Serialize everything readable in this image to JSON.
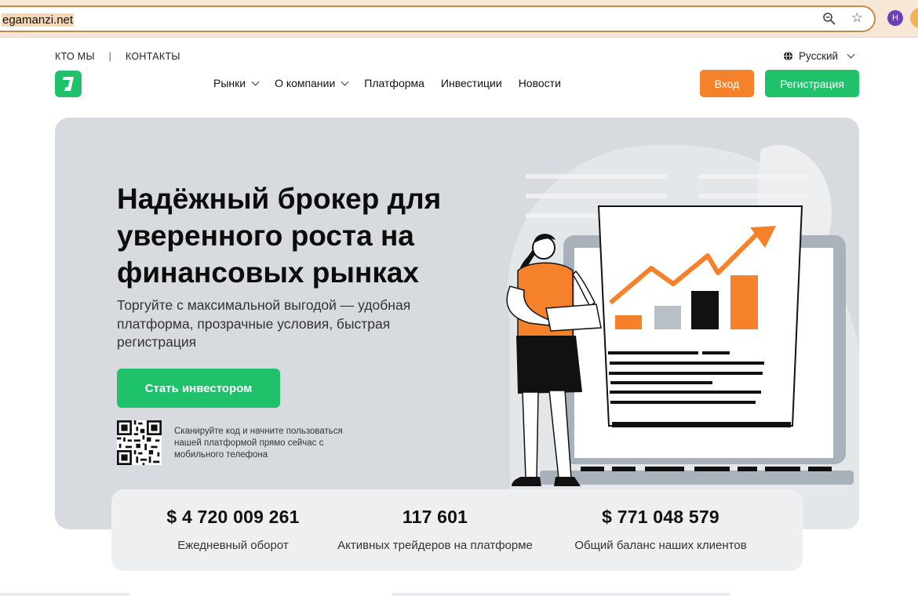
{
  "browser": {
    "url": "egamanzi.net",
    "profile_initial": "H"
  },
  "toplinks": {
    "about": "КТО МЫ",
    "separator": "|",
    "contacts": "КОНТАКТЫ"
  },
  "language": {
    "label": "Русский",
    "icon": "globe-icon"
  },
  "nav": {
    "items": [
      {
        "label": "Рынки",
        "dropdown": true
      },
      {
        "label": "О компании",
        "dropdown": true
      },
      {
        "label": "Платформа",
        "dropdown": false
      },
      {
        "label": "Инвестиции",
        "dropdown": false
      },
      {
        "label": "Новости",
        "dropdown": false
      }
    ]
  },
  "auth": {
    "login": "Вход",
    "register": "Регистрация"
  },
  "hero": {
    "title": "Надёжный брокер для уверенного роста на финансовых рынках",
    "subtitle": "Торгуйте с максимальной выгодой — удобная платформа, прозрачные условия, быстрая регистрация",
    "cta": "Стать инвестором",
    "qr_text": "Сканируйте код и начните пользоваться нашей платформой прямо сейчас с мобильного телефона"
  },
  "stats": [
    {
      "value": "$ 4 720 009 261",
      "label": "Ежедневный оборот"
    },
    {
      "value": "117 601",
      "label": "Активных трейдеров на платформе"
    },
    {
      "value": "$ 771 048 579",
      "label": "Общий баланс наших клиентов"
    }
  ],
  "colors": {
    "green": "#1fc26b",
    "orange": "#f5822a",
    "hero_bg": "#d7dbe0"
  }
}
